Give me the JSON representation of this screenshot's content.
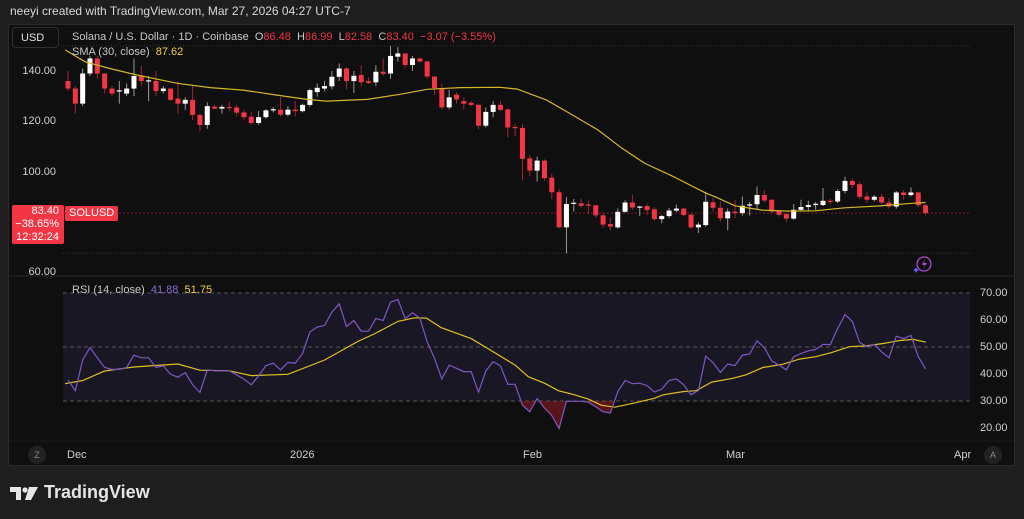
{
  "header": {
    "attribution": "neeyi created with TradingView.com, Mar 27, 2026 04:27 UTC-7"
  },
  "toolbar": {
    "currency_button": "USD"
  },
  "legend": {
    "symbol_desc": "Solana / U.S. Dollar · 1D · Coinbase",
    "o_label": "O",
    "o": "86.48",
    "h_label": "H",
    "h": "86.99",
    "l_label": "L",
    "l": "82.58",
    "c_label": "C",
    "c": "83.40",
    "change": "−3.07 (−3.55%)",
    "sma_label": "SMA (30, close)",
    "sma_value": "87.62"
  },
  "price_tag": {
    "price": "83.40",
    "change_pct": "−38.65%",
    "countdown": "12:32:24",
    "symbol": "SOLUSD"
  },
  "rsi_legend": {
    "label": "RSI (14, close)",
    "rsi_value": "41.88",
    "ma_value": "51.75"
  },
  "axis_buttons": {
    "left": "Z",
    "right": "A"
  },
  "logo": {
    "text": "TradingView"
  },
  "colors": {
    "up": "#ffffff",
    "down": "#f23645",
    "sma": "#d4b62a",
    "rsi": "#7e57c2",
    "rsi_ma": "#e0c020"
  },
  "chart_data": [
    {
      "type": "candlestick",
      "title": "Solana / U.S. Dollar · 1D · Coinbase",
      "ylim": [
        57,
        157
      ],
      "price_ticks": [
        "140.00",
        "120.00",
        "100.00",
        "60.00"
      ],
      "price_tick_values": [
        140,
        120,
        100,
        60
      ],
      "time_ticks": [
        {
          "label": "Dec",
          "index": 1
        },
        {
          "label": "2026",
          "index": 32
        },
        {
          "label": "Feb",
          "index": 63
        },
        {
          "label": "Mar",
          "index": 91
        },
        {
          "label": "Apr",
          "index": 122
        }
      ],
      "ohlc": [
        [
          136,
          140,
          132,
          133
        ],
        [
          133,
          134,
          123,
          127
        ],
        [
          127,
          141,
          126,
          139
        ],
        [
          139,
          146,
          138,
          145
        ],
        [
          145,
          146,
          137,
          139
        ],
        [
          139,
          139,
          131,
          133
        ],
        [
          133,
          134,
          130,
          131
        ],
        [
          132,
          136,
          127,
          132.3
        ],
        [
          131,
          135,
          130,
          133
        ],
        [
          133,
          145,
          130,
          138
        ],
        [
          138,
          142,
          134,
          136
        ],
        [
          136,
          138,
          128,
          136.3
        ],
        [
          136,
          140,
          130,
          132
        ],
        [
          132,
          134,
          131,
          133
        ],
        [
          133,
          133,
          128,
          128.5
        ],
        [
          129,
          136,
          123,
          127
        ],
        [
          127,
          129.5,
          124.5,
          128.5
        ],
        [
          128.5,
          134,
          120.5,
          122.5
        ],
        [
          122.5,
          123,
          116,
          118.5
        ],
        [
          118.5,
          127.5,
          117,
          126
        ],
        [
          125.8,
          126.5,
          124.8,
          125
        ],
        [
          125,
          126.5,
          123,
          125.7
        ],
        [
          125.7,
          128,
          124,
          125.5
        ],
        [
          125.5,
          126.5,
          122,
          123.4
        ],
        [
          123.5,
          124.5,
          120.5,
          121.6
        ],
        [
          121.8,
          123.6,
          118.6,
          119.3
        ],
        [
          119.3,
          124,
          118.6,
          121.6
        ],
        [
          121.6,
          124.8,
          121,
          124.3
        ],
        [
          124.3,
          125.6,
          123.5,
          124.8
        ],
        [
          124.6,
          129.6,
          122,
          122.6
        ],
        [
          122.6,
          126,
          122,
          124.6
        ],
        [
          124.6,
          128,
          122,
          124
        ],
        [
          124,
          127,
          123.5,
          126.5
        ],
        [
          126.5,
          133,
          125.8,
          132.4
        ],
        [
          131.6,
          135,
          129.8,
          133.3
        ],
        [
          133,
          136,
          132,
          134
        ],
        [
          133.9,
          140,
          132.7,
          137.7
        ],
        [
          137.7,
          143,
          136,
          141
        ],
        [
          141,
          141.5,
          132.7,
          136
        ],
        [
          136,
          140,
          131.3,
          138.1
        ],
        [
          138.4,
          142.3,
          134,
          135.5
        ],
        [
          135.9,
          137.6,
          134.8,
          135.2
        ],
        [
          135.5,
          142.3,
          134,
          139.7
        ],
        [
          139.7,
          145,
          138,
          138.9
        ],
        [
          139,
          150,
          136.9,
          146
        ],
        [
          145.7,
          149.5,
          143.8,
          147
        ],
        [
          147,
          147,
          141,
          142.4
        ],
        [
          142.4,
          146,
          140,
          145
        ],
        [
          145,
          145.3,
          143.3,
          143.8
        ],
        [
          143.8,
          144,
          137,
          137.8
        ],
        [
          137.8,
          138,
          130.5,
          133.2
        ],
        [
          133.2,
          135,
          124.7,
          125.5
        ],
        [
          125.5,
          132.4,
          124.7,
          129.5
        ],
        [
          130.6,
          131.5,
          127,
          128.7
        ],
        [
          128,
          129.5,
          124.7,
          127
        ],
        [
          127.3,
          128,
          126,
          126.5
        ],
        [
          126.5,
          127,
          116.8,
          118.2
        ],
        [
          118.2,
          125.5,
          117.5,
          123.7
        ],
        [
          123.7,
          128,
          121.5,
          126.5
        ],
        [
          126.5,
          128,
          124,
          124.5
        ],
        [
          124.7,
          125,
          113.5,
          117.5
        ],
        [
          117.7,
          119,
          114,
          117.4
        ],
        [
          117.3,
          118.8,
          96.5,
          105
        ],
        [
          105.2,
          106.6,
          98,
          100.3
        ],
        [
          100.3,
          105.9,
          96,
          104.3
        ],
        [
          104.3,
          104.8,
          96.3,
          97.3
        ],
        [
          97.5,
          99,
          89,
          91.7
        ],
        [
          91.7,
          93,
          77.3,
          77.7
        ],
        [
          77.7,
          89.7,
          67.4,
          87
        ],
        [
          87.2,
          89,
          84,
          87.5
        ],
        [
          87.3,
          89,
          85.5,
          86.3
        ],
        [
          86.8,
          88.3,
          83,
          86.6
        ],
        [
          86.5,
          86.5,
          81.6,
          82.5
        ],
        [
          82.5,
          83.8,
          77.5,
          78.8
        ],
        [
          79,
          81.7,
          76.5,
          78
        ],
        [
          77.7,
          85.2,
          77.2,
          83.9
        ],
        [
          83.9,
          88.5,
          83.6,
          87.6
        ],
        [
          87.6,
          90.8,
          84.6,
          85.6
        ],
        [
          85.7,
          86.3,
          82.3,
          86
        ],
        [
          86.2,
          87.2,
          82.6,
          84.6
        ],
        [
          84.9,
          85.7,
          80.3,
          81
        ],
        [
          81,
          82.6,
          79.3,
          82.2
        ],
        [
          82.2,
          85.5,
          81.5,
          84.4
        ],
        [
          84.4,
          86.8,
          83.9,
          85.2
        ],
        [
          85.2,
          85.6,
          82.3,
          82.6
        ],
        [
          82.8,
          82.8,
          77,
          77.7
        ],
        [
          77.7,
          79.7,
          75.5,
          78.8
        ],
        [
          78.6,
          91.9,
          78,
          87.9
        ],
        [
          87.7,
          89.3,
          84,
          85.5
        ],
        [
          85.5,
          87.8,
          80,
          81.3
        ],
        [
          81.3,
          85.3,
          76.6,
          84
        ],
        [
          84,
          88.7,
          81.3,
          83.4
        ],
        [
          83.4,
          90,
          82.4,
          86.3
        ],
        [
          86.4,
          87.8,
          82.4,
          86.9
        ],
        [
          86.9,
          94,
          84.8,
          90.6
        ],
        [
          90.6,
          92.6,
          87.7,
          88.4
        ],
        [
          88.7,
          89,
          83.4,
          84
        ],
        [
          84.3,
          84.7,
          82,
          82.7
        ],
        [
          83,
          83.4,
          79.9,
          81.2
        ],
        [
          81.2,
          87,
          80.7,
          84.7
        ],
        [
          84.7,
          88.7,
          84,
          85.8
        ],
        [
          85.8,
          88.3,
          84,
          86.6
        ],
        [
          86.7,
          87.8,
          84.7,
          87.1
        ],
        [
          86.6,
          93.4,
          86.2,
          88.3
        ],
        [
          88.3,
          89.2,
          86.9,
          87.9
        ],
        [
          88,
          92.9,
          87.4,
          92.2
        ],
        [
          92.2,
          97.9,
          91.2,
          96.2
        ],
        [
          96.2,
          97.1,
          93.3,
          94.6
        ],
        [
          94.9,
          95.8,
          88.9,
          89.9
        ],
        [
          90,
          91.6,
          87.4,
          88.7
        ],
        [
          88.7,
          90.5,
          88,
          89.9
        ],
        [
          89.9,
          91,
          87,
          87.6
        ],
        [
          87.6,
          89.3,
          85.2,
          86
        ],
        [
          86,
          92.2,
          85.2,
          91.6
        ],
        [
          91.6,
          92.5,
          88.9,
          90.6
        ],
        [
          90.6,
          93.6,
          90,
          91.6
        ],
        [
          91.6,
          92,
          85.6,
          86.5
        ],
        [
          86.48,
          86.99,
          82.58,
          83.4
        ]
      ],
      "sma30": [
        [
          -0.4,
          148.4
        ],
        [
          2.3,
          143.7
        ],
        [
          5.7,
          141
        ],
        [
          9.4,
          138.4
        ],
        [
          14.9,
          135.1
        ],
        [
          19.4,
          133.4
        ],
        [
          23.9,
          132.4
        ],
        [
          28.5,
          130.4
        ],
        [
          32.6,
          128.7
        ],
        [
          35.3,
          128
        ],
        [
          40.8,
          128.7
        ],
        [
          45.3,
          130.7
        ],
        [
          49,
          132.7
        ],
        [
          53.5,
          133.4
        ],
        [
          58.9,
          133.5
        ],
        [
          61.3,
          132.8
        ],
        [
          65.3,
          128.4
        ],
        [
          68.8,
          122.5
        ],
        [
          72.3,
          116.5
        ],
        [
          75.6,
          109.2
        ],
        [
          78.7,
          103.2
        ],
        [
          82.4,
          98.2
        ],
        [
          86.9,
          91.5
        ],
        [
          88.3,
          89.9
        ],
        [
          91,
          86.3
        ],
        [
          94.7,
          84.6
        ],
        [
          98.2,
          84.2
        ],
        [
          101.9,
          84.3
        ],
        [
          106,
          85.5
        ],
        [
          110.5,
          86.2
        ],
        [
          115.1,
          87.3
        ],
        [
          117,
          87.62
        ]
      ],
      "period_high": 150,
      "period_low": 67.4,
      "last_price": 83.4
    },
    {
      "type": "line",
      "title": "RSI (14, close)",
      "ylim": [
        15,
        75
      ],
      "ticks": [
        "70.00",
        "60.00",
        "50.00",
        "40.00",
        "30.00",
        "20.00"
      ],
      "tick_values": [
        70,
        60,
        50,
        40,
        30,
        20
      ],
      "bands": {
        "upper": 70,
        "middle": 50,
        "lower": 30
      },
      "rsi": [
        37.8,
        33.8,
        45.2,
        49.8,
        46,
        42.4,
        41.7,
        41.7,
        42.4,
        47,
        46,
        46,
        42.4,
        43,
        39.9,
        38.8,
        40.5,
        36,
        33.2,
        41.5,
        41.2,
        41.2,
        41.2,
        39.7,
        38.1,
        36,
        39.3,
        43.1,
        44,
        41.5,
        44.3,
        44,
        47.6,
        55.6,
        57.4,
        58,
        62.9,
        66,
        57.6,
        59.8,
        55.9,
        55.8,
        60.5,
        59.8,
        66.6,
        67.6,
        60.5,
        62.7,
        60.7,
        51.9,
        45.8,
        38.2,
        43.3,
        42.1,
        40.9,
        40.9,
        33.3,
        41.1,
        44.6,
        43,
        36.2,
        36.2,
        28.4,
        26,
        30.9,
        27.4,
        24.6,
        19.8,
        29.9,
        29.9,
        29.9,
        29.6,
        27.8,
        26,
        25.6,
        33.5,
        37.6,
        36.4,
        36.6,
        35.7,
        33.3,
        34.4,
        37.6,
        38.2,
        36,
        32.3,
        33.9,
        46.6,
        44.2,
        40.6,
        43.7,
        43.1,
        47,
        47.4,
        52.3,
        49.7,
        44.9,
        43.3,
        41.5,
        46.4,
        47.6,
        48.6,
        49.1,
        51,
        50.9,
        56.8,
        62,
        59.5,
        51.7,
        50.1,
        51,
        48.2,
        46,
        54,
        53.1,
        54.3,
        46.4,
        41.88
      ],
      "rsi_ma": [
        [
          -0.4,
          36.4
        ],
        [
          2,
          37.6
        ],
        [
          5,
          41.1
        ],
        [
          9,
          42.6
        ],
        [
          15,
          43.7
        ],
        [
          18,
          41.4
        ],
        [
          22,
          41.2
        ],
        [
          25,
          39.4
        ],
        [
          30,
          39.9
        ],
        [
          35,
          45.2
        ],
        [
          39.5,
          52
        ],
        [
          41.9,
          55
        ],
        [
          45,
          59.5
        ],
        [
          47.3,
          60.8
        ],
        [
          48.9,
          60.7
        ],
        [
          50.9,
          57.2
        ],
        [
          55,
          53.1
        ],
        [
          57.3,
          49.4
        ],
        [
          61,
          43.3
        ],
        [
          62.8,
          39
        ],
        [
          65,
          36.6
        ],
        [
          66.9,
          33.8
        ],
        [
          69.1,
          32.3
        ],
        [
          71,
          30.7
        ],
        [
          72.8,
          28.4
        ],
        [
          74.6,
          27.7
        ],
        [
          77.3,
          29.3
        ],
        [
          80,
          31
        ],
        [
          81.2,
          32.3
        ],
        [
          83.9,
          33.5
        ],
        [
          85.7,
          33.8
        ],
        [
          87.8,
          37
        ],
        [
          90.7,
          38.4
        ],
        [
          92.5,
          39.7
        ],
        [
          94.8,
          42.4
        ],
        [
          97.5,
          43.6
        ],
        [
          99.8,
          45.5
        ],
        [
          102,
          46.4
        ],
        [
          104.1,
          47.9
        ],
        [
          106.6,
          50.1
        ],
        [
          108.9,
          50.4
        ],
        [
          111.2,
          51.3
        ],
        [
          113.5,
          52.4
        ],
        [
          115.3,
          52.8
        ],
        [
          116.9,
          51.9
        ],
        [
          117,
          51.75
        ]
      ]
    }
  ]
}
